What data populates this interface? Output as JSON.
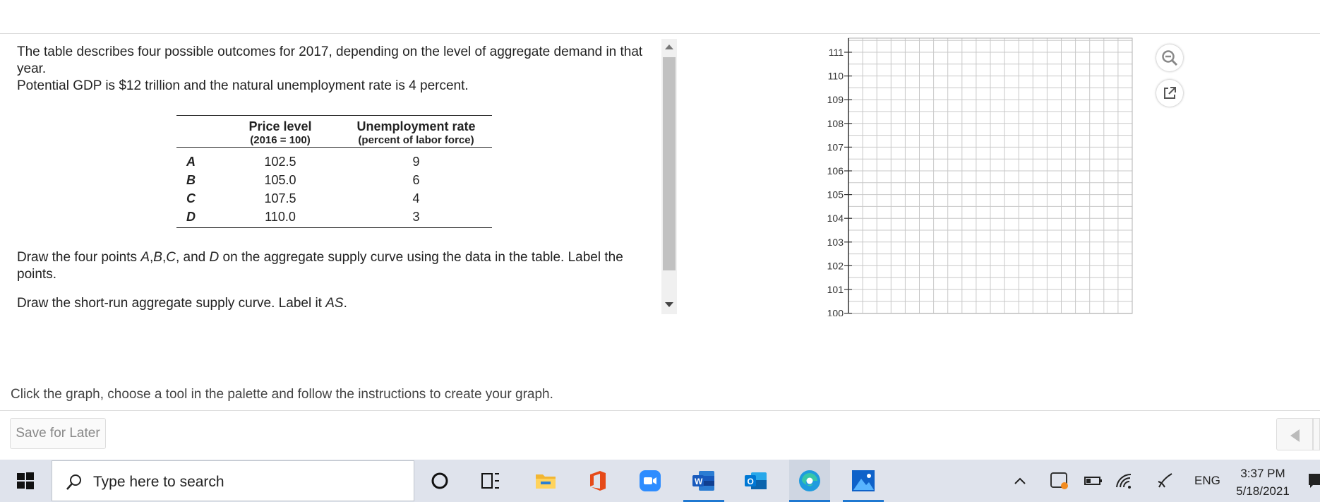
{
  "question": {
    "intro": "The table describes four possible outcomes for 2017, depending on the level of aggregate demand in that year.",
    "gdp": "Potential GDP is $12 trillion and the natural unemployment rate is 4 percent.",
    "draw_points_pre": "Draw the four points ",
    "draw_points_A": "A",
    "draw_points_B": "B",
    "draw_points_C": "C",
    "draw_points_mid": ", and ",
    "draw_points_D": "D",
    "draw_points_post": " on the aggregate supply curve using the data in the table. Label the points.",
    "draw_curve_pre": "Draw the short-run aggregate supply curve. Label it ",
    "draw_curve_AS": "AS",
    "draw_curve_post": "."
  },
  "table": {
    "col1_title": "Price level",
    "col1_sub": "(2016 = 100)",
    "col2_title": "Unemployment rate",
    "col2_sub": "(percent of labor force)",
    "rows": [
      {
        "label": "A",
        "price": "102.5",
        "unemp": "9"
      },
      {
        "label": "B",
        "price": "105.0",
        "unemp": "6"
      },
      {
        "label": "C",
        "price": "107.5",
        "unemp": "4"
      },
      {
        "label": "D",
        "price": "110.0",
        "unemp": "3"
      }
    ]
  },
  "graph": {
    "y_ticks": [
      "111",
      "110",
      "109",
      "108",
      "107",
      "106",
      "105",
      "104",
      "103",
      "102",
      "101",
      "100"
    ]
  },
  "instruction": "Click the graph, choose a tool in the palette and follow the instructions to create your graph.",
  "save_label": "Save for Later",
  "taskbar": {
    "search_placeholder": "Type here to search",
    "lang": "ENG",
    "time": "3:37 PM",
    "date": "5/18/2021"
  },
  "icons": {
    "zoom": "zoom-out-icon",
    "popout": "popout-icon"
  }
}
